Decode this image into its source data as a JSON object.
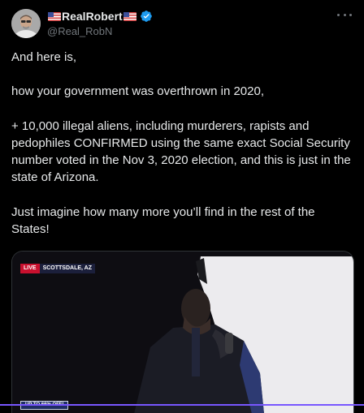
{
  "author": {
    "display_name": "RealRobert",
    "handle": "@Real_RobN",
    "verified": true,
    "name_flag_icon": "us-flag-icon",
    "verified_icon": "verified-badge-icon"
  },
  "more_icon": "more-options-icon",
  "tweet": {
    "paragraphs": [
      "And here is,",
      "how your government was overthrown in 2020,",
      "+ 10,000 illegal aliens, including murderers, rapists and pedophiles CONFIRMED using the same exact Social Security number voted in the Nov 3, 2020 election, and this is just in the state of Arizona.",
      "Just imagine how many more you’ll find in the rest of the States!"
    ]
  },
  "media": {
    "live_label": "LIVE",
    "location": "SCOTTSDALE, AZ",
    "promo": "UP TO 66% OFF!"
  },
  "colors": {
    "background": "#000000",
    "text": "#e7e9ea",
    "secondary_text": "#71767b",
    "verified_blue": "#1d9bf0",
    "live_red": "#c8102e",
    "accent": "#7856ff"
  }
}
